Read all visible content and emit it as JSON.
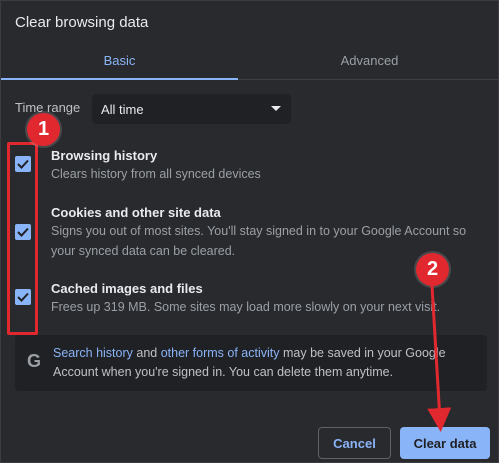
{
  "dialog": {
    "title": "Clear browsing data",
    "tabs": [
      {
        "label": "Basic",
        "selected": true
      },
      {
        "label": "Advanced",
        "selected": false
      }
    ],
    "time_range": {
      "label": "Time range",
      "value": "All time"
    },
    "items": [
      {
        "title": "Browsing history",
        "desc": "Clears history from all synced devices",
        "checked": true
      },
      {
        "title": "Cookies and other site data",
        "desc": "Signs you out of most sites. You'll stay signed in to your Google Account so your synced data can be cleared.",
        "checked": true
      },
      {
        "title": "Cached images and files",
        "desc": "Frees up 319 MB. Some sites may load more slowly on your next visit.",
        "checked": true
      }
    ],
    "info": {
      "icon": "G",
      "link1": "Search history",
      "mid": " and ",
      "link2": "other forms of activity",
      "rest": " may be saved in your Google Account when you're signed in. You can delete them anytime."
    },
    "buttons": {
      "cancel": "Cancel",
      "clear": "Clear data"
    }
  },
  "annotations": {
    "badge1": "1",
    "badge2": "2",
    "color": "#e0282e"
  },
  "colors": {
    "accent": "#8ab4f8",
    "background": "#292a2d"
  }
}
